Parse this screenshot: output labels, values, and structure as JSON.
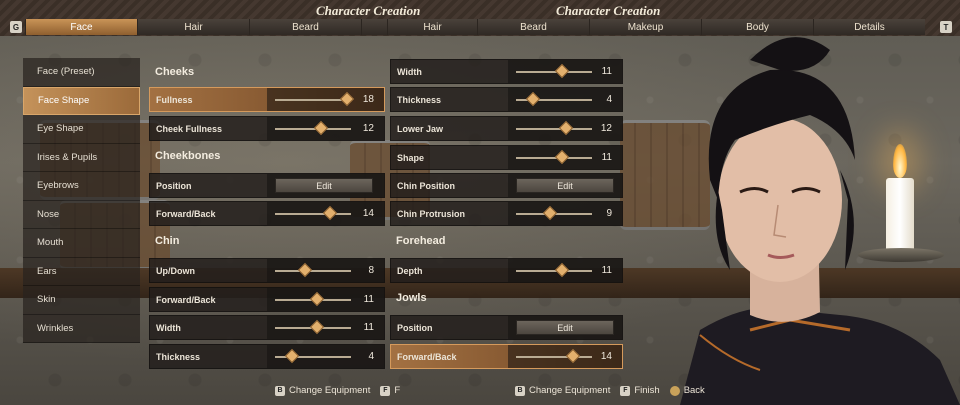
{
  "header": {
    "title": "Character Creation",
    "key_left": "G",
    "key_right": "T",
    "left_tabs": [
      "Face",
      "Hair",
      "Beard"
    ],
    "right_tabs": [
      "Hair",
      "Beard",
      "Makeup",
      "Body",
      "Details"
    ],
    "active_tab": "Face"
  },
  "categories": [
    "Face (Preset)",
    "Face Shape",
    "Eye Shape",
    "Irises & Pupils",
    "Eyebrows",
    "Nose",
    "Mouth",
    "Ears",
    "Skin",
    "Wrinkles"
  ],
  "active_category": "Face Shape",
  "left_panel": {
    "cheeks_heading": "Cheeks",
    "fullness": {
      "label": "Fullness",
      "value": "18"
    },
    "cheek_fullness": {
      "label": "Cheek Fullness",
      "value": "12"
    },
    "cheekbones_heading": "Cheekbones",
    "cb_position": {
      "label": "Position",
      "button": "Edit"
    },
    "cb_forward_back": {
      "label": "Forward/Back",
      "value": "14"
    },
    "chin_heading": "Chin",
    "chin_up_down": {
      "label": "Up/Down",
      "value": "8"
    },
    "chin_forward_back": {
      "label": "Forward/Back",
      "value": "11"
    },
    "chin_width": {
      "label": "Width",
      "value": "11"
    },
    "chin_thickness": {
      "label": "Thickness",
      "value": "4"
    }
  },
  "right_panel": {
    "width": {
      "label": "Width",
      "value": "11"
    },
    "thickness": {
      "label": "Thickness",
      "value": "4"
    },
    "lower_jaw": {
      "label": "Lower Jaw",
      "value": "12"
    },
    "shape": {
      "label": "Shape",
      "value": "11"
    },
    "chin_position": {
      "label": "Chin Position",
      "button": "Edit"
    },
    "chin_protrusion": {
      "label": "Chin Protrusion",
      "value": "9"
    },
    "forehead_heading": "Forehead",
    "depth": {
      "label": "Depth",
      "value": "11"
    },
    "jowls_heading": "Jowls",
    "jowls_position": {
      "label": "Position",
      "button": "Edit"
    },
    "jowls_forward_back": {
      "label": "Forward/Back",
      "value": "14"
    }
  },
  "slider_levels": {
    "fullness": 0.95,
    "cheek_fullness": 0.6,
    "cb_forward_back": 0.72,
    "chin_up_down": 0.4,
    "chin_forward_back": 0.55,
    "chin_width": 0.55,
    "chin_thickness": 0.22,
    "width": 0.6,
    "thickness": 0.22,
    "lower_jaw": 0.66,
    "shape": 0.6,
    "chin_protrusion": 0.45,
    "depth": 0.6,
    "jowls_forward_back": 0.75
  },
  "footer": {
    "change_key": "B",
    "change_label": "Change Equipment",
    "finish_key": "F",
    "finish_label": "Finish",
    "back_label": "Back",
    "left_finish_partial": "F"
  },
  "colors": {
    "accent": "#c99457",
    "active_row": "#a37142"
  }
}
